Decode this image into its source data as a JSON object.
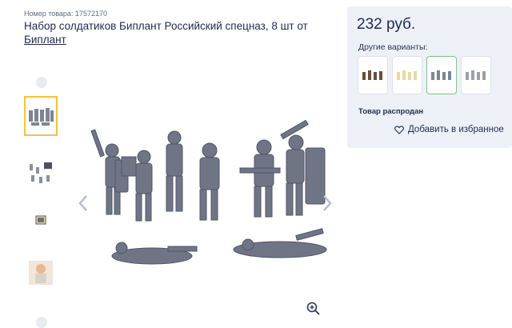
{
  "product": {
    "sku_label": "Номер товара: 17572170",
    "title_main": "Набор солдатиков Биплант Российский спецназ, 8 шт от",
    "brand_link": "Биплант"
  },
  "purchase": {
    "price": "232 руб.",
    "variants_label": "Другие варианты:",
    "variant_colors": [
      "#6b4e3a",
      "#e8d9a0",
      "#7d8494",
      "#9aa0aa"
    ],
    "status": "Товар распродан",
    "favorite_label": "Добавить в избранное"
  },
  "icons": {
    "heart": "heart-icon",
    "zoom": "zoom-in-icon",
    "prev": "chevron-left-icon",
    "next": "chevron-right-icon"
  }
}
